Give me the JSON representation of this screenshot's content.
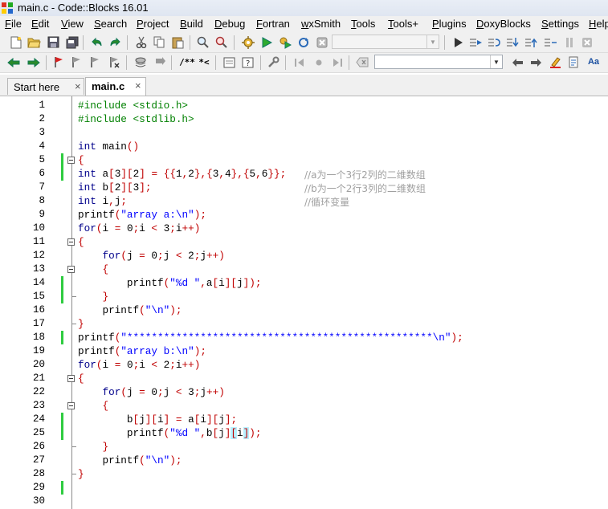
{
  "window": {
    "title": "main.c - Code::Blocks 16.01"
  },
  "menu": [
    "File",
    "Edit",
    "View",
    "Search",
    "Project",
    "Build",
    "Debug",
    "Fortran",
    "wxSmith",
    "Tools",
    "Tools+",
    "Plugins",
    "DoxyBlocks",
    "Settings",
    "Help"
  ],
  "toolbar": {
    "build_target_value": "",
    "symbol_value": "",
    "comment_block_label": "/**",
    "comment_line_label": "*<"
  },
  "tabs": [
    {
      "label": "Start here",
      "active": false,
      "close": "×"
    },
    {
      "label": "main.c",
      "active": true,
      "close": "×"
    }
  ],
  "editor": {
    "line_numbers": [
      "1",
      "2",
      "3",
      "4",
      "5",
      "6",
      "7",
      "8",
      "9",
      "10",
      "11",
      "12",
      "13",
      "14",
      "15",
      "16",
      "17",
      "18",
      "19",
      "20",
      "21",
      "22",
      "23",
      "24",
      "25",
      "26",
      "27",
      "28",
      "29",
      "30"
    ],
    "comments": {
      "6": "//a为一个3行2列的二维数组",
      "7": "//b为一个2行3列的二维数组",
      "8": "//循环变量"
    },
    "code_lines": [
      "#include <stdio.h>",
      "#include <stdlib.h>",
      "",
      "int main()",
      "{",
      "int a[3][2] = {{1,2},{3,4},{5,6}};",
      "int b[2][3];",
      "int i,j;",
      "printf(\"array a:\\n\");",
      "for(i = 0;i < 3;i++)",
      "{",
      "    for(j = 0;j < 2;j++)",
      "    {",
      "        printf(\"%d \",a[i][j]);",
      "    }",
      "    printf(\"\\n\");",
      "}",
      "printf(\"**************************************************\\n\");",
      "printf(\"array b:\\n\");",
      "for(i = 0;i < 2;i++)",
      "{",
      "    for(j = 0;j < 3;j++)",
      "    {",
      "        b[j][i] = a[i][j];",
      "        printf(\"%d \",b[j][i]);",
      "    }",
      "    printf(\"\\n\");",
      "}",
      "",
      ""
    ]
  },
  "icons": [
    "new-file-icon",
    "open-icon",
    "save-icon",
    "save-all-icon",
    "undo-icon",
    "redo-icon",
    "cut-icon",
    "copy-icon",
    "paste-icon",
    "find-icon",
    "replace-icon",
    "build-icon",
    "run-icon",
    "build-run-icon",
    "abort-icon",
    "debug-icon",
    "bookmark-icon"
  ],
  "colors": {
    "keyword": "#00008b",
    "preprocessor": "#008000",
    "operator": "#c00000",
    "string": "#0000ff",
    "comment": "#a0a0a0",
    "change_bar": "#2ecc40"
  }
}
